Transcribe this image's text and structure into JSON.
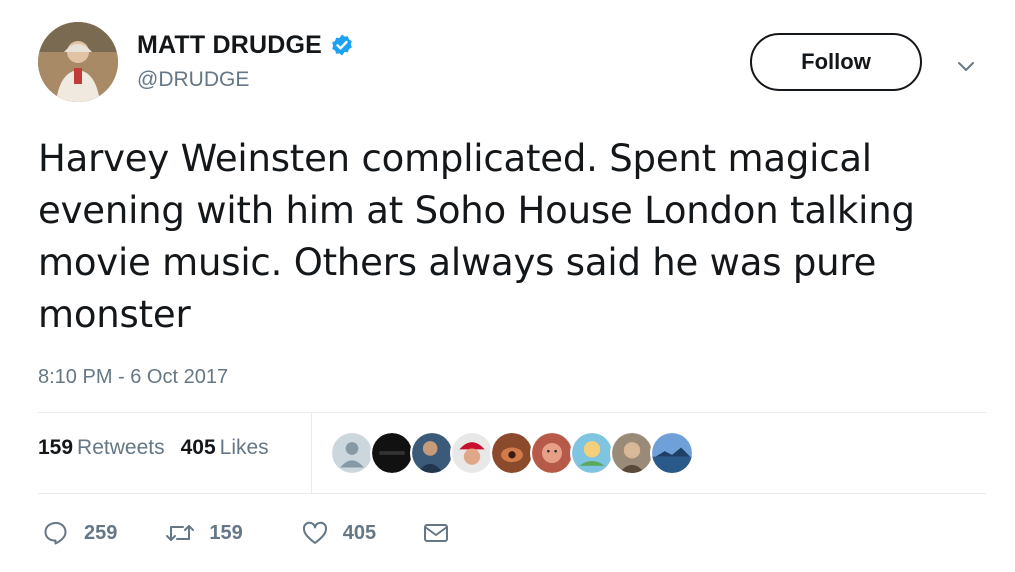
{
  "author": {
    "display_name": "MATT DRUDGE",
    "handle": "@DRUDGE",
    "verified": true,
    "avatar_icon": "profile-photo"
  },
  "follow_button": {
    "label": "Follow"
  },
  "menu_icon": "chevron-down-icon",
  "tweet": {
    "text": "Harvey Weinsten complicated. Spent magical evening with him at Soho House London talking movie music. Others always said he was pure monster",
    "timestamp": "8:10 PM - 6 Oct 2017"
  },
  "stats": {
    "retweets_count": "159",
    "retweets_label": "Retweets",
    "likes_count": "405",
    "likes_label": "Likes"
  },
  "likers": [
    {
      "name": "default-avatar",
      "color": "#ccd6dd"
    },
    {
      "name": "dark-avatar",
      "color": "#111111"
    },
    {
      "name": "person-avatar-1",
      "color": "#3b5a7a"
    },
    {
      "name": "red-cap-avatar",
      "color": "#c8102e"
    },
    {
      "name": "brown-avatar",
      "color": "#8b4a2b"
    },
    {
      "name": "face-avatar",
      "color": "#d98a6a"
    },
    {
      "name": "cartoon-avatar",
      "color": "#7fc4e0"
    },
    {
      "name": "person-avatar-2",
      "color": "#9a8a78"
    },
    {
      "name": "landscape-avatar",
      "color": "#3d6fa8"
    }
  ],
  "actions": {
    "reply_count": "259",
    "retweet_count": "159",
    "like_count": "405"
  },
  "colors": {
    "text_primary": "#14171a",
    "text_secondary": "#657786",
    "divider": "#e6ecf0",
    "verified_blue": "#1da1f2"
  }
}
